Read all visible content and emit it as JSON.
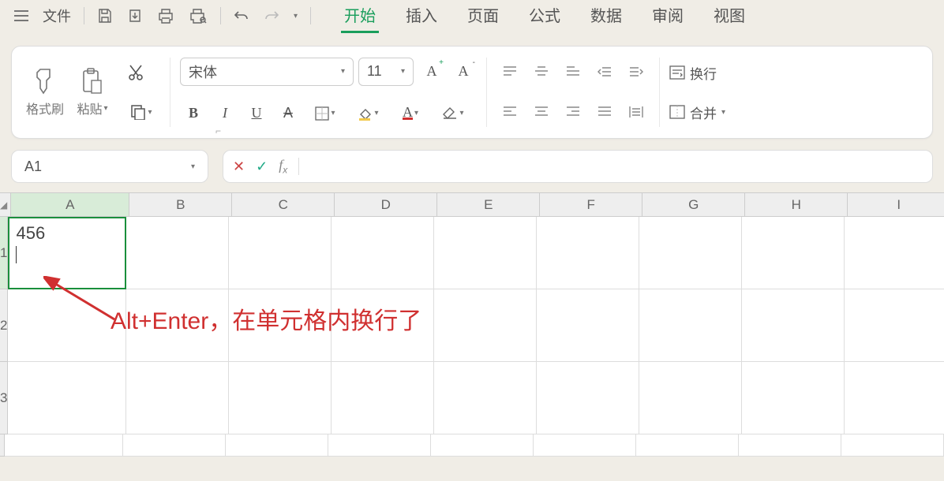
{
  "menubar": {
    "file_label": "文件",
    "tabs": [
      {
        "label": "开始",
        "active": true
      },
      {
        "label": "插入",
        "active": false
      },
      {
        "label": "页面",
        "active": false
      },
      {
        "label": "公式",
        "active": false
      },
      {
        "label": "数据",
        "active": false
      },
      {
        "label": "审阅",
        "active": false
      },
      {
        "label": "视图",
        "active": false
      }
    ]
  },
  "ribbon": {
    "format_painter_label": "格式刷",
    "paste_label": "粘贴",
    "font_name": "宋体",
    "font_size": "11",
    "wrap_text_label": "换行",
    "merge_label": "合并"
  },
  "name_box": {
    "value": "A1"
  },
  "grid": {
    "columns": [
      "A",
      "B",
      "C",
      "D",
      "E",
      "F",
      "G",
      "H",
      "I"
    ],
    "rows": [
      "1",
      "2",
      "3"
    ],
    "active_cell": {
      "row": 0,
      "col": 0,
      "value": "456"
    }
  },
  "annotation": {
    "text": "Alt+Enter，在单元格内换行了"
  }
}
